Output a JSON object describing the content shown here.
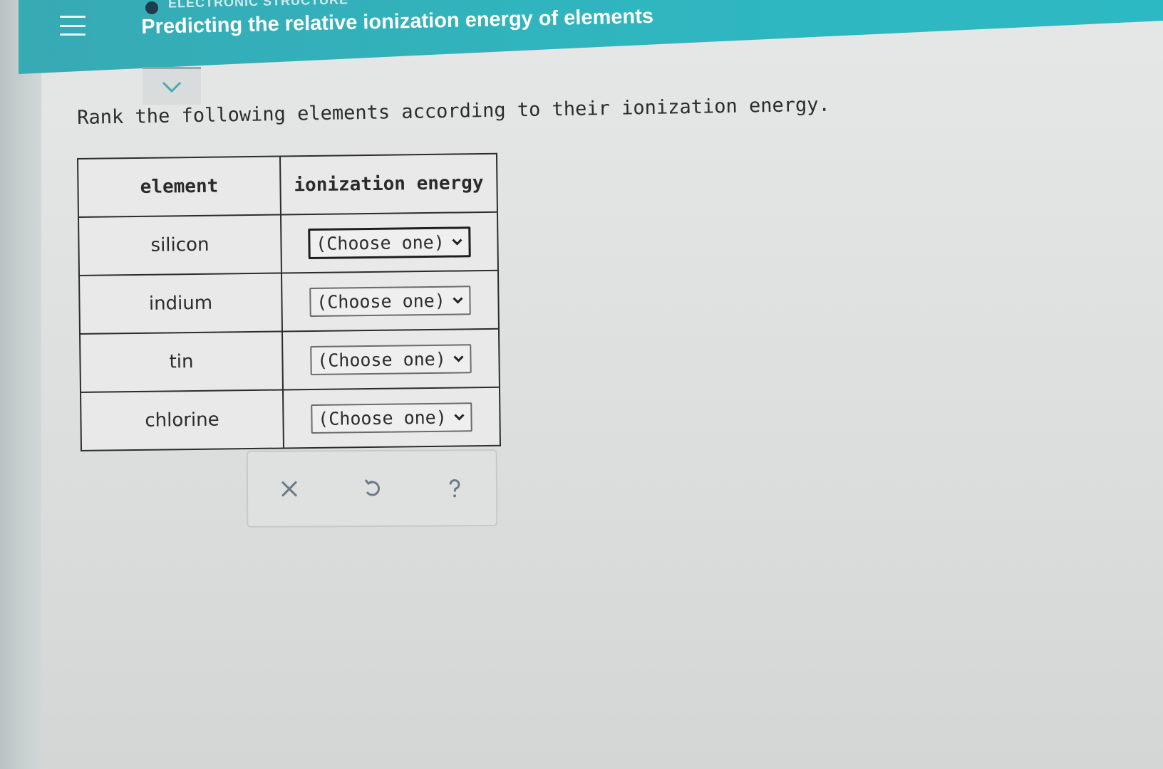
{
  "header": {
    "kicker": "ELECTRONIC STRUCTURE",
    "title": "Predicting the relative ionization energy of elements",
    "menu_icon": "hamburger-menu-icon",
    "accent_color": "#2fb6bf"
  },
  "collapse_icon": "chevron-down-icon",
  "question": {
    "prompt": "Rank the following elements according to their ionization energy."
  },
  "table": {
    "headers": [
      "element",
      "ionization energy"
    ],
    "rows": [
      {
        "element": "silicon",
        "selection": "(Choose one)"
      },
      {
        "element": "indium",
        "selection": "(Choose one)"
      },
      {
        "element": "tin",
        "selection": "(Choose one)"
      },
      {
        "element": "chlorine",
        "selection": "(Choose one)"
      }
    ]
  },
  "toolbar": {
    "buttons": [
      {
        "name": "clear",
        "icon": "close-icon"
      },
      {
        "name": "undo",
        "icon": "undo-icon"
      },
      {
        "name": "help",
        "icon": "help-icon"
      }
    ]
  }
}
